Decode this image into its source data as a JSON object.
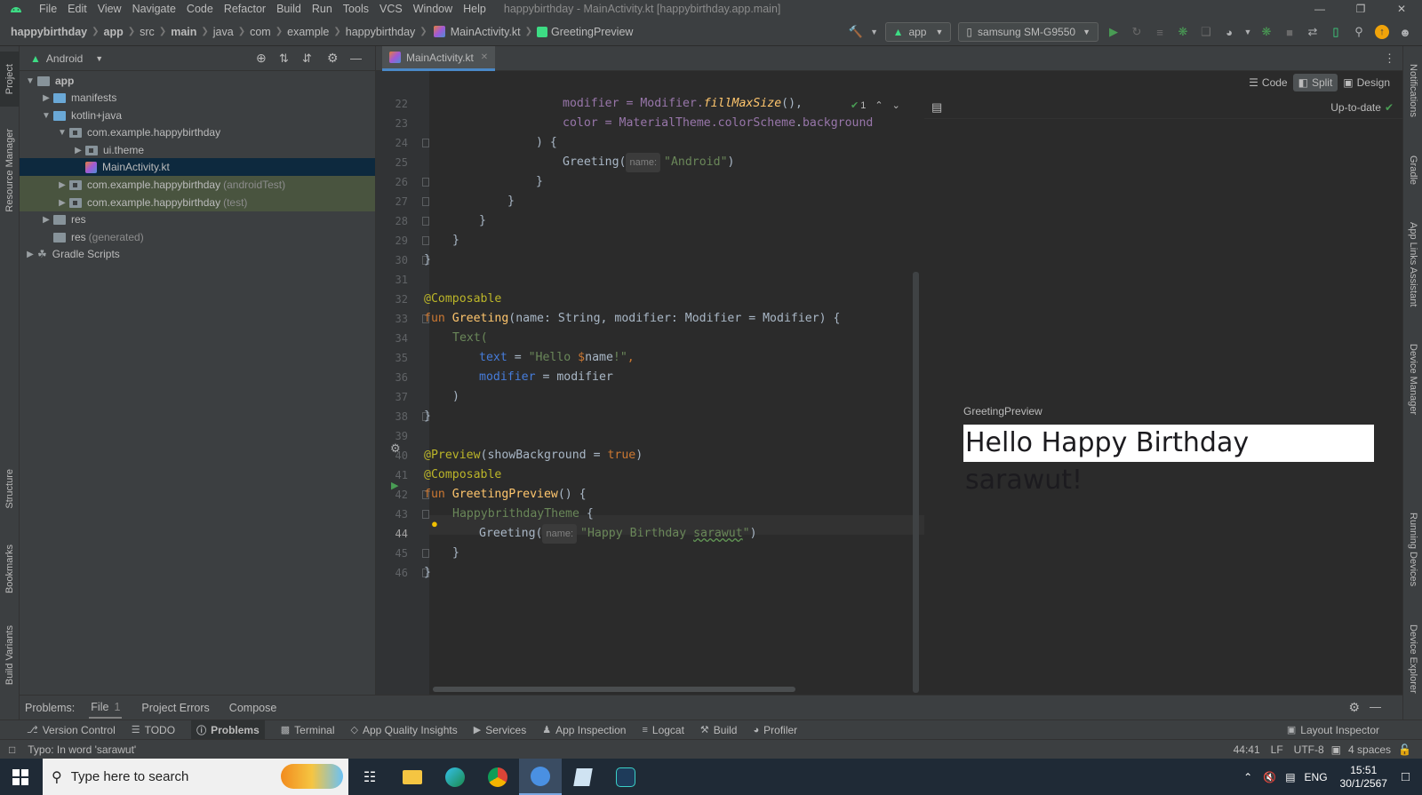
{
  "menubar": {
    "items": [
      "File",
      "Edit",
      "View",
      "Navigate",
      "Code",
      "Refactor",
      "Build",
      "Run",
      "Tools",
      "VCS",
      "Window",
      "Help"
    ],
    "title": "happybirthday - MainActivity.kt [happybirthday.app.main]"
  },
  "nav": {
    "breadcrumbs": [
      "happybirthday",
      "app",
      "src",
      "main",
      "java",
      "com",
      "example",
      "happybirthday",
      "MainActivity.kt",
      "GreetingPreview"
    ],
    "run_config": "app",
    "device": "samsung SM-G9550"
  },
  "left_strip": {
    "project": "Project",
    "resource_manager": "Resource Manager",
    "structure": "Structure",
    "bookmarks": "Bookmarks",
    "build_variants": "Build Variants"
  },
  "right_strip": {
    "notifications": "Notifications",
    "gradle": "Gradle",
    "app_links": "App Links Assistant",
    "device_manager": "Device Manager",
    "running_devices": "Running Devices",
    "device_explorer": "Device Explorer"
  },
  "project": {
    "view": "Android",
    "tree": [
      {
        "label": "app",
        "note": ""
      },
      {
        "label": "manifests",
        "note": ""
      },
      {
        "label": "kotlin+java",
        "note": ""
      },
      {
        "label": "com.example.happybirthday",
        "note": ""
      },
      {
        "label": "ui.theme",
        "note": ""
      },
      {
        "label": "MainActivity.kt",
        "note": ""
      },
      {
        "label": "com.example.happybirthday",
        "note": "(androidTest)"
      },
      {
        "label": "com.example.happybirthday",
        "note": "(test)"
      },
      {
        "label": "res",
        "note": ""
      },
      {
        "label": "res",
        "note": "(generated)"
      },
      {
        "label": "Gradle Scripts",
        "note": ""
      }
    ]
  },
  "editor": {
    "tab": "MainActivity.kt",
    "line_numbers": [
      "22",
      "23",
      "24",
      "25",
      "26",
      "27",
      "28",
      "29",
      "30",
      "31",
      "32",
      "33",
      "34",
      "35",
      "36",
      "37",
      "38",
      "39",
      "40",
      "41",
      "42",
      "43",
      "44",
      "45",
      "46"
    ],
    "check_count": "1",
    "name_hint": "name:",
    "code": {
      "l22a": "modifier = Modifier.",
      "l22b": "fillMaxSize",
      "l22c": "(),",
      "l23a": "color = MaterialTheme.",
      "l23b": "colorScheme",
      "l23c": ".",
      "l23d": "background",
      "l24": ") {",
      "l25a": "Greeting(",
      "l25b": "\"Android\"",
      "l25c": ")",
      "l26": "}",
      "l27": "}",
      "l28": "}",
      "l29": "}",
      "l30": "}",
      "l32": "@Composable",
      "l33a": "fun ",
      "l33b": "Greeting",
      "l33c": "(name: String, modifier: Modifier = Modifier) {",
      "l34": "Text(",
      "l35a": "text",
      "l35b": " = ",
      "l35c": "\"Hello ",
      "l35d": "$",
      "l35e": "name",
      "l35f": "!\"",
      "l35g": ",",
      "l36a": "modifier",
      "l36b": " = modifier",
      "l37": ")",
      "l38": "}",
      "l40a": "@Preview",
      "l40b": "(showBackground = ",
      "l40c": "true",
      "l40d": ")",
      "l41": "@Composable",
      "l42a": "fun ",
      "l42b": "GreetingPreview",
      "l42c": "() {",
      "l43a": "HappybrithdayTheme",
      "l43b": " {",
      "l44a": "Greeting(",
      "l44b": "\"Happy Birthday ",
      "l44c": "sarawut",
      "l44d": "\"",
      "l44e": ")",
      "l45": "}",
      "l46": "}"
    }
  },
  "split": {
    "code": "Code",
    "split": "Split",
    "design": "Design",
    "status": "Up-to-date"
  },
  "preview": {
    "label": "GreetingPreview",
    "greeting_text": "Hello Happy Birthday sarawut!"
  },
  "problems": {
    "label": "Problems:",
    "tabs": [
      "File",
      "Project Errors",
      "Compose"
    ],
    "file_count": "1"
  },
  "tools": [
    "Version Control",
    "TODO",
    "Problems",
    "Terminal",
    "App Quality Insights",
    "Services",
    "App Inspection",
    "Logcat",
    "Build",
    "Profiler"
  ],
  "layout_inspector": "Layout Inspector",
  "status": {
    "message": "Typo: In word 'sarawut'",
    "position": "44:41",
    "line_sep": "LF",
    "encoding": "UTF-8",
    "indent": "4 spaces"
  },
  "taskbar": {
    "search_placeholder": "Type here to search",
    "time": "15:51",
    "date": "30/1/2567",
    "lang": "ENG"
  }
}
